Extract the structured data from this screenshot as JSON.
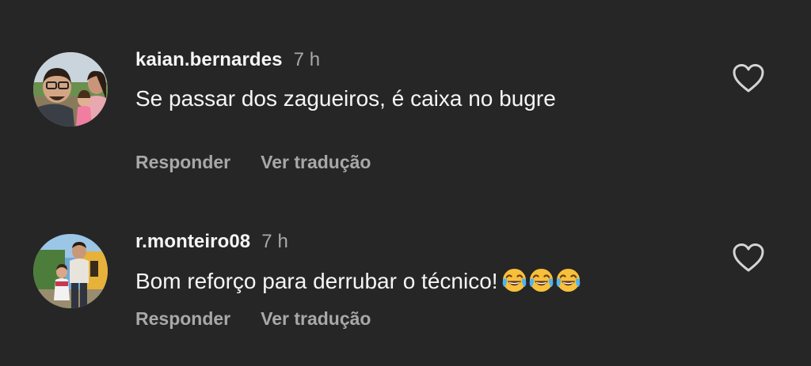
{
  "comments": [
    {
      "username": "kaian.bernardes",
      "time": "7 h",
      "text": "Se passar dos zagueiros, é caixa no bugre",
      "reply_label": "Responder",
      "translate_label": "Ver tradução",
      "like_icon": "heart-outline-icon"
    },
    {
      "username": "r.monteiro08",
      "time": "7 h",
      "text": "Bom reforço para derrubar o técnico!",
      "emoji": "😂😂😂",
      "reply_label": "Responder",
      "translate_label": "Ver tradução",
      "like_icon": "heart-outline-icon"
    }
  ],
  "colors": {
    "background": "#262626",
    "primary_text": "#f5f5f5",
    "secondary_text": "#a8a8a8"
  }
}
